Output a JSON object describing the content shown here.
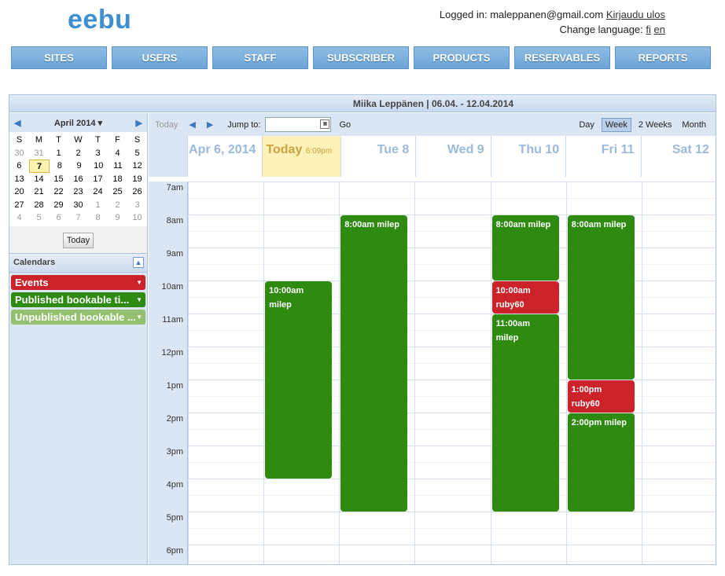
{
  "header": {
    "logo": "eebu",
    "logged_in_label": "Logged in: maleppanen@gmail.com",
    "logout_link": "Kirjaudu ulos",
    "change_language_label": "Change language:",
    "lang_fi": "fi",
    "lang_en": "en"
  },
  "nav": [
    "SITES",
    "USERS",
    "STAFF",
    "SUBSCRIBER",
    "PRODUCTS",
    "RESERVABLES",
    "REPORTS"
  ],
  "calendar_title": "Miika Leppänen | 06.04. - 12.04.2014",
  "mini_calendar": {
    "month_label": "April 2014",
    "dow": [
      "S",
      "M",
      "T",
      "W",
      "T",
      "F",
      "S"
    ],
    "weeks": [
      [
        {
          "d": "30",
          "o": true
        },
        {
          "d": "31",
          "o": true
        },
        {
          "d": "1"
        },
        {
          "d": "2"
        },
        {
          "d": "3"
        },
        {
          "d": "4"
        },
        {
          "d": "5"
        }
      ],
      [
        {
          "d": "6"
        },
        {
          "d": "7",
          "t": true
        },
        {
          "d": "8"
        },
        {
          "d": "9"
        },
        {
          "d": "10"
        },
        {
          "d": "11"
        },
        {
          "d": "12"
        }
      ],
      [
        {
          "d": "13"
        },
        {
          "d": "14"
        },
        {
          "d": "15"
        },
        {
          "d": "16"
        },
        {
          "d": "17"
        },
        {
          "d": "18"
        },
        {
          "d": "19"
        }
      ],
      [
        {
          "d": "20"
        },
        {
          "d": "21"
        },
        {
          "d": "22"
        },
        {
          "d": "23"
        },
        {
          "d": "24"
        },
        {
          "d": "25"
        },
        {
          "d": "26"
        }
      ],
      [
        {
          "d": "27"
        },
        {
          "d": "28"
        },
        {
          "d": "29"
        },
        {
          "d": "30"
        },
        {
          "d": "1",
          "o": true
        },
        {
          "d": "2",
          "o": true
        },
        {
          "d": "3",
          "o": true
        }
      ],
      [
        {
          "d": "4",
          "o": true
        },
        {
          "d": "5",
          "o": true
        },
        {
          "d": "6",
          "o": true
        },
        {
          "d": "7",
          "o": true
        },
        {
          "d": "8",
          "o": true
        },
        {
          "d": "9",
          "o": true
        },
        {
          "d": "10",
          "o": true
        }
      ]
    ],
    "today_button": "Today"
  },
  "calendars": {
    "heading": "Calendars",
    "items": [
      {
        "label": "Events",
        "color": "#cc2229"
      },
      {
        "label": "Published bookable ti...",
        "color": "#2e8b10"
      },
      {
        "label": "Unpublished bookable ...",
        "color": "#93bf6e"
      }
    ]
  },
  "toolbar": {
    "today": "Today",
    "jump_to": "Jump to:",
    "jump_value": "",
    "go": "Go",
    "views": [
      "Day",
      "Week",
      "2 Weeks",
      "Month"
    ],
    "active_view": "Week"
  },
  "days": [
    {
      "label": "Apr 6, 2014"
    },
    {
      "label": "Today",
      "time": "6:09pm",
      "today": true
    },
    {
      "label": "Tue 8"
    },
    {
      "label": "Wed 9"
    },
    {
      "label": "Thu 10"
    },
    {
      "label": "Fri 11"
    },
    {
      "label": "Sat 12"
    }
  ],
  "hours": [
    "7am",
    "8am",
    "9am",
    "10am",
    "11am",
    "12pm",
    "1pm",
    "2pm",
    "3pm",
    "4pm",
    "5pm",
    "6pm"
  ],
  "events": [
    {
      "day": 1,
      "start": 10,
      "end": 16.0,
      "time": "10:00am",
      "title": "milep",
      "kind": "published"
    },
    {
      "day": 2,
      "start": 8,
      "end": 17,
      "time": "8:00am",
      "title": "milep",
      "kind": "published"
    },
    {
      "day": 4,
      "start": 8,
      "end": 10,
      "time": "8:00am",
      "title": "milep",
      "kind": "published"
    },
    {
      "day": 4,
      "start": 10,
      "end": 11,
      "time": "10:00am",
      "title": "ruby60",
      "kind": "event"
    },
    {
      "day": 4,
      "start": 11,
      "end": 17,
      "time": "11:00am",
      "title": "milep",
      "kind": "published"
    },
    {
      "day": 5,
      "start": 8,
      "end": 13,
      "time": "8:00am",
      "title": "milep",
      "kind": "published"
    },
    {
      "day": 5,
      "start": 13,
      "end": 14,
      "time": "1:00pm",
      "title": "ruby60",
      "kind": "event"
    },
    {
      "day": 5,
      "start": 14,
      "end": 17,
      "time": "2:00pm",
      "title": "milep",
      "kind": "published"
    }
  ]
}
